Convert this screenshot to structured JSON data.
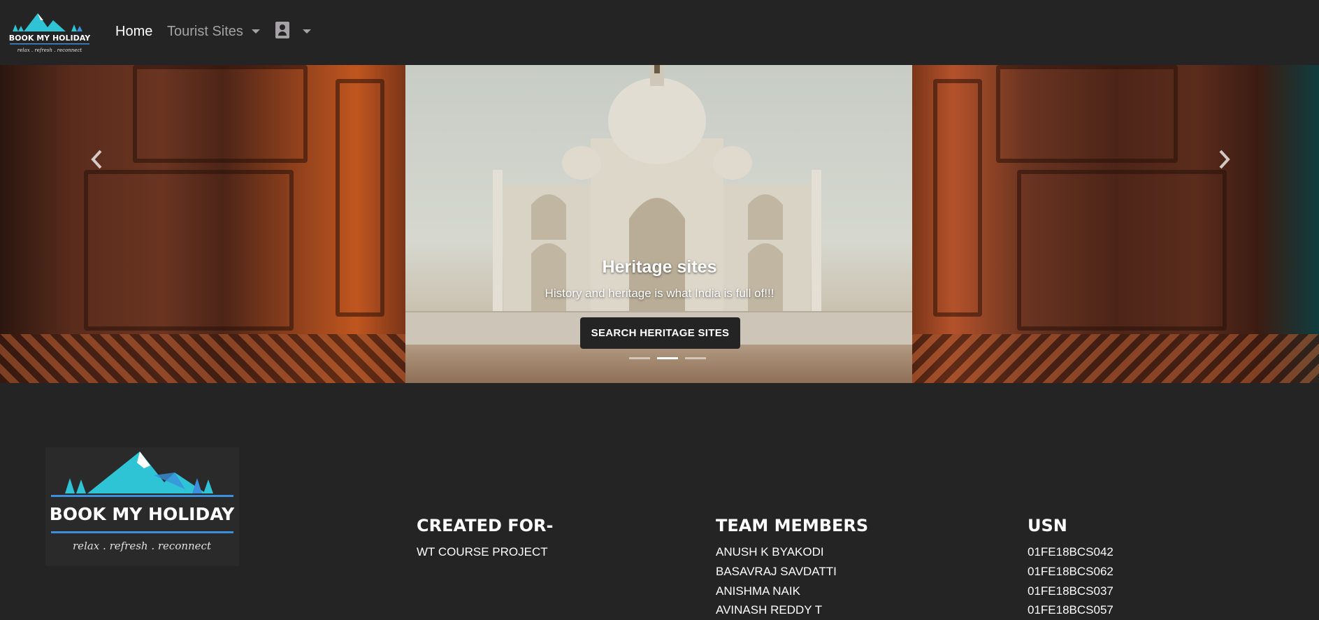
{
  "brand": {
    "name": "BOOK MY HOLIDAY",
    "tagline": "relax . refresh . reconnect",
    "colors": {
      "teal": "#2ec4d6",
      "blue": "#3b8fdc",
      "navbar_bg": "#252425"
    }
  },
  "navbar": {
    "home": "Home",
    "tourist_sites": "Tourist Sites",
    "user_icon": "user-contact-icon"
  },
  "carousel": {
    "title": "Heritage sites",
    "text": "History and heritage is what India is full of!!!",
    "button": "SEARCH HERITAGE SITES",
    "prev_icon": "chevron-left-icon",
    "next_icon": "chevron-right-icon",
    "slide_count": 3,
    "active_slide": 2
  },
  "footer": {
    "created_for": {
      "heading": "CREATED FOR-",
      "lines": [
        "WT COURSE PROJECT"
      ]
    },
    "team": {
      "heading": "TEAM MEMBERS",
      "members": [
        "ANUSH K BYAKODI",
        "BASAVRAJ SAVDATTI",
        "ANISHMA NAIK",
        "AVINASH REDDY T"
      ]
    },
    "usn": {
      "heading": "USN",
      "values": [
        "01FE18BCS042",
        "01FE18BCS062",
        "01FE18BCS037",
        "01FE18BCS057"
      ]
    }
  }
}
